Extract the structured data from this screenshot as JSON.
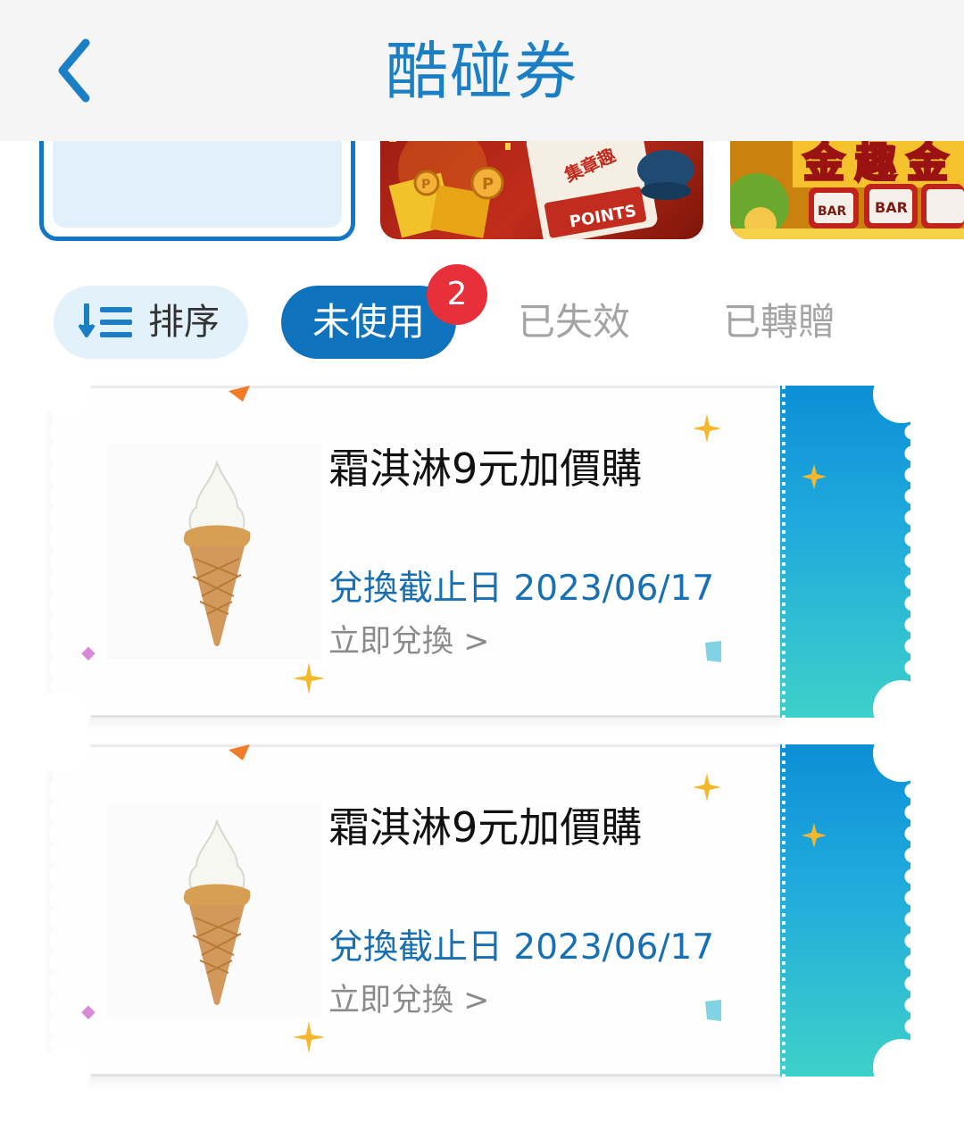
{
  "header": {
    "title": "酷碰券",
    "back_icon": "chevron-left-icon"
  },
  "tabs": {
    "sort_label": "排序",
    "sort_icon": "sort-icon",
    "active_label": "未使用",
    "active_count": "2",
    "expired_label": "已失效",
    "transferred_label": "已轉贈"
  },
  "coupons": [
    {
      "title": "霜淇淋9元加價購",
      "deadline": "兌換截止日 2023/06/17",
      "action": "立即兌換 >",
      "image": "ice-cream-cone"
    },
    {
      "title": "霜淇淋9元加價購",
      "deadline": "兌換截止日 2023/06/17",
      "action": "立即兌換 >",
      "image": "ice-cream-cone"
    }
  ],
  "banners": {
    "banner2_label": "POINTS",
    "banner2_stamp": "集章趣",
    "banner3_labels": [
      "BAR",
      "BAR"
    ]
  },
  "colors": {
    "accent": "#0f72bd",
    "title_blue": "#1a7fc4",
    "badge": "#e8303a",
    "stub_gradient_start": "#0c8fd6",
    "stub_gradient_end": "#3dd0c9"
  }
}
